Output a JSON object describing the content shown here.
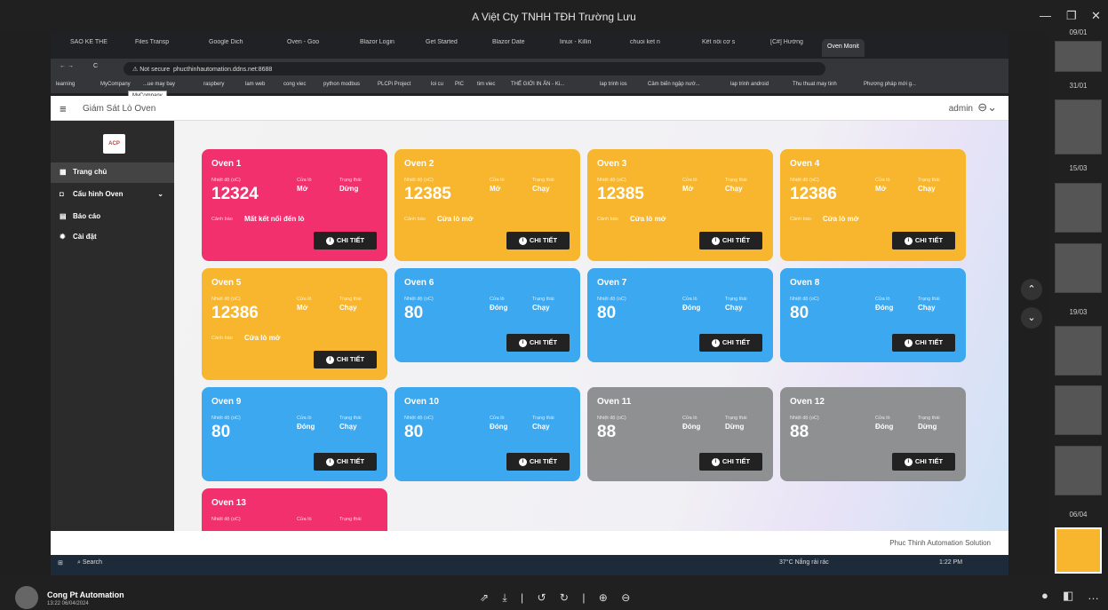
{
  "window": {
    "title": "A Việt Cty TNHH TĐH Trường Lưu"
  },
  "browser": {
    "tabs": [
      "SAO KE THE",
      "Files Transp",
      "Google Dich",
      "Oven - Goo",
      "Blazor Login",
      "Get Started",
      "Blazor Date",
      "linux - Killin",
      "chuoi ket n",
      "Kết nối cơ s",
      "[C#] Hướng",
      "Oven Monit"
    ],
    "url_security": "Not secure",
    "url": "phucthinhautomation.ddns.net:8688",
    "bookmarks": [
      "learning",
      "MyCompany",
      "...ue may bay",
      "raspbery",
      "lam web",
      "cong viec",
      "python modbus",
      "PLCPi Project",
      "loi cu",
      "PIC",
      "tim viec",
      "THẾ GIỚI IN ẤN - Ki...",
      "lap trinh ios",
      "Cảm biến ngập nướ...",
      "lap trinh android",
      "Thu thuat may tinh",
      "Phương pháp mới g..."
    ],
    "tooltip": "MyCompany"
  },
  "app": {
    "title": "Giám Sát Lò Oven",
    "user": "admin",
    "logo": "ACP",
    "footer": "Phuc Thinh Automation Solution"
  },
  "sidebar": {
    "items": [
      {
        "label": "Trang chủ",
        "icon": "grid-icon"
      },
      {
        "label": "Cấu hình Oven",
        "icon": "settings-box-icon"
      },
      {
        "label": "Báo cáo",
        "icon": "file-icon"
      },
      {
        "label": "Cài đặt",
        "icon": "gear-icon"
      }
    ]
  },
  "labels": {
    "temp": "Nhiệt độ (oC)",
    "door": "Cửa lò",
    "status": "Trạng thái",
    "warning": "Cảnh báo",
    "detail": "CHI TIẾT"
  },
  "ovens": [
    {
      "name": "Oven 1",
      "temp": "12324",
      "door": "Mở",
      "status": "Dừng",
      "warning": "Mất kết nối đến lò",
      "color": "#f2306d"
    },
    {
      "name": "Oven 2",
      "temp": "12385",
      "door": "Mở",
      "status": "Chạy",
      "warning": "Cửa lò mở",
      "color": "#f7b62e"
    },
    {
      "name": "Oven 3",
      "temp": "12385",
      "door": "Mở",
      "status": "Chạy",
      "warning": "Cửa lò mở",
      "color": "#f7b62e"
    },
    {
      "name": "Oven 4",
      "temp": "12386",
      "door": "Mở",
      "status": "Chạy",
      "warning": "Cửa lò mở",
      "color": "#f7b62e"
    },
    {
      "name": "Oven 5",
      "temp": "12386",
      "door": "Mở",
      "status": "Chạy",
      "warning": "Cửa lò mở",
      "color": "#f7b62e"
    },
    {
      "name": "Oven 6",
      "temp": "80",
      "door": "Đóng",
      "status": "Chạy",
      "warning": "",
      "color": "#3ba8ef"
    },
    {
      "name": "Oven 7",
      "temp": "80",
      "door": "Đóng",
      "status": "Chạy",
      "warning": "",
      "color": "#3ba8ef"
    },
    {
      "name": "Oven 8",
      "temp": "80",
      "door": "Đóng",
      "status": "Chạy",
      "warning": "",
      "color": "#3ba8ef"
    },
    {
      "name": "Oven 9",
      "temp": "80",
      "door": "Đóng",
      "status": "Chạy",
      "warning": "",
      "color": "#3ba8ef"
    },
    {
      "name": "Oven 10",
      "temp": "80",
      "door": "Đóng",
      "status": "Chạy",
      "warning": "",
      "color": "#3ba8ef"
    },
    {
      "name": "Oven 11",
      "temp": "88",
      "door": "Đóng",
      "status": "Dừng",
      "warning": "",
      "color": "#8e9092"
    },
    {
      "name": "Oven 12",
      "temp": "88",
      "door": "Đóng",
      "status": "Dừng",
      "warning": "",
      "color": "#8e9092"
    },
    {
      "name": "Oven 13",
      "temp": "",
      "door": "",
      "status": "",
      "warning": "",
      "color": "#f2306d"
    }
  ],
  "taskbar": {
    "search": "Search",
    "weather": "37°C Nắng rải rác",
    "time": "1:22 PM"
  },
  "viewer": {
    "dates": [
      "09/01",
      "31/01",
      "15/03",
      "19/03",
      "06/04"
    ],
    "owner": "Cong Pt Automation",
    "timestamp": "13:22 06/04/2024"
  }
}
